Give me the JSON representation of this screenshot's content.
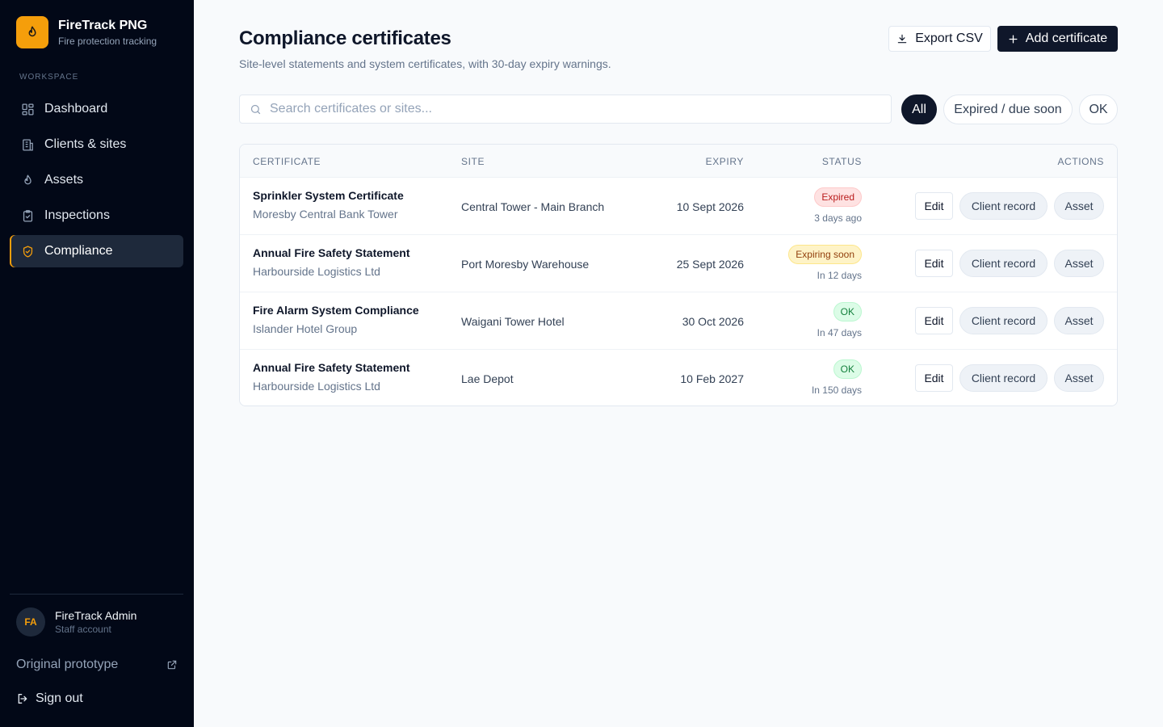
{
  "brand": {
    "name": "FireTrack PNG",
    "subtitle": "Fire protection tracking",
    "accent": "#f59e0b",
    "icon": "flame-icon"
  },
  "sidebar": {
    "section_label": "WORKSPACE",
    "items": [
      {
        "label": "Dashboard",
        "icon": "grid-icon",
        "active": false
      },
      {
        "label": "Clients & sites",
        "icon": "building-icon",
        "active": false
      },
      {
        "label": "Assets",
        "icon": "flame-icon",
        "active": false
      },
      {
        "label": "Inspections",
        "icon": "clipboard-check-icon",
        "active": false
      },
      {
        "label": "Compliance",
        "icon": "shield-check-icon",
        "active": true
      }
    ],
    "user": {
      "initials": "FA",
      "name": "FireTrack Admin",
      "role": "Staff account"
    },
    "prototype_link": "Original prototype",
    "sign_out": "Sign out"
  },
  "header": {
    "title": "Compliance certificates",
    "subtitle": "Site-level statements and system certificates, with 30-day expiry warnings.",
    "export_label": "Export CSV",
    "add_label": "Add certificate"
  },
  "search": {
    "placeholder": "Search certificates or sites...",
    "value": ""
  },
  "filters": {
    "all": "All",
    "expired": "Expired / due soon",
    "ok": "OK",
    "selected": "All"
  },
  "table": {
    "columns": {
      "certificate": "CERTIFICATE",
      "site": "SITE",
      "expiry": "EXPIRY",
      "status": "STATUS",
      "actions": "ACTIONS"
    },
    "action_labels": {
      "edit": "Edit",
      "client": "Client record",
      "asset": "Asset"
    },
    "rows": [
      {
        "title": "Sprinkler System Certificate",
        "client": "Moresby Central Bank Tower",
        "site": "Central Tower - Main Branch",
        "expiry": "10 Sept 2026",
        "status": "Expired",
        "status_kind": "expired",
        "relative": "3 days ago"
      },
      {
        "title": "Annual Fire Safety Statement",
        "client": "Harbourside Logistics Ltd",
        "site": "Port Moresby Warehouse",
        "expiry": "25 Sept 2026",
        "status": "Expiring soon",
        "status_kind": "soon",
        "relative": "In 12 days"
      },
      {
        "title": "Fire Alarm System Compliance",
        "client": "Islander Hotel Group",
        "site": "Waigani Tower Hotel",
        "expiry": "30 Oct 2026",
        "status": "OK",
        "status_kind": "ok",
        "relative": "In 47 days"
      },
      {
        "title": "Annual Fire Safety Statement",
        "client": "Harbourside Logistics Ltd",
        "site": "Lae Depot",
        "expiry": "10 Feb 2027",
        "status": "OK",
        "status_kind": "ok",
        "relative": "In 150 days"
      }
    ]
  }
}
